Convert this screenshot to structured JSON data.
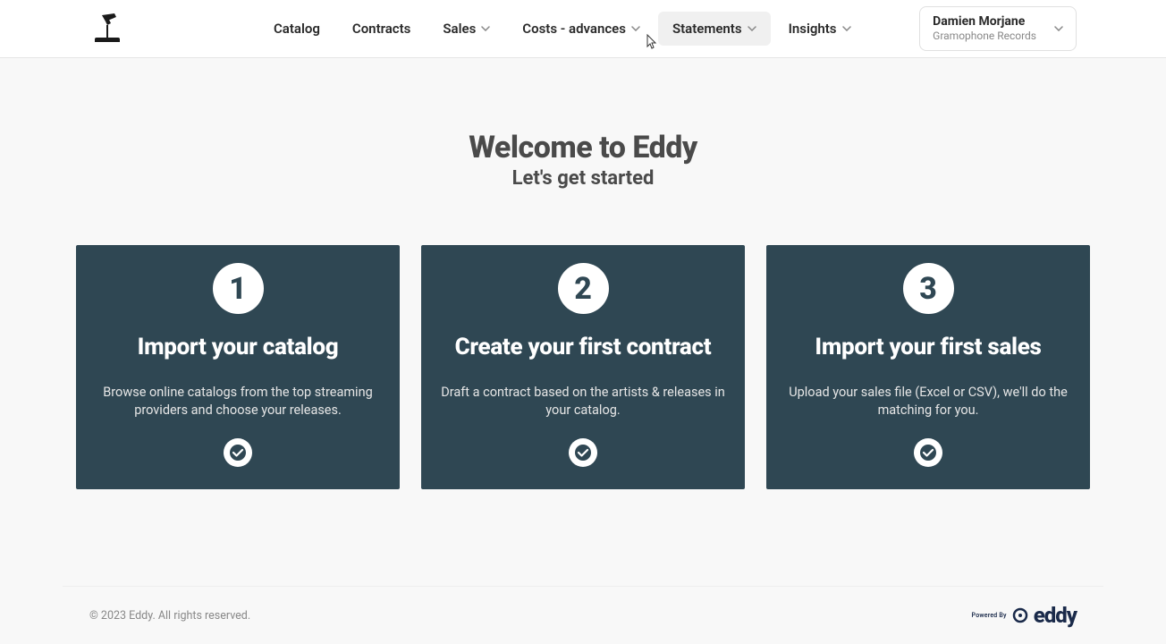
{
  "nav": {
    "items": [
      {
        "label": "Catalog",
        "has_dropdown": false
      },
      {
        "label": "Contracts",
        "has_dropdown": false
      },
      {
        "label": "Sales",
        "has_dropdown": true
      },
      {
        "label": "Costs - advances",
        "has_dropdown": true
      },
      {
        "label": "Statements",
        "has_dropdown": true
      },
      {
        "label": "Insights",
        "has_dropdown": true
      }
    ]
  },
  "user": {
    "name": "Damien Morjane",
    "org": "Gramophone Records"
  },
  "hero": {
    "title": "Welcome to Eddy",
    "subtitle": "Let's get started"
  },
  "cards": [
    {
      "step": "1",
      "title": "Import your catalog",
      "desc": "Browse online catalogs from the top streaming providers and choose your releases."
    },
    {
      "step": "2",
      "title": "Create your first contract",
      "desc": "Draft a contract based on the artists & releases in your catalog."
    },
    {
      "step": "3",
      "title": "Import your first sales",
      "desc": "Upload your sales file (Excel or CSV), we'll do the matching for you."
    }
  ],
  "footer": {
    "copyright": "© 2023 Eddy. All rights reserved.",
    "powered_by": "Powered By",
    "brand": "eddy"
  }
}
